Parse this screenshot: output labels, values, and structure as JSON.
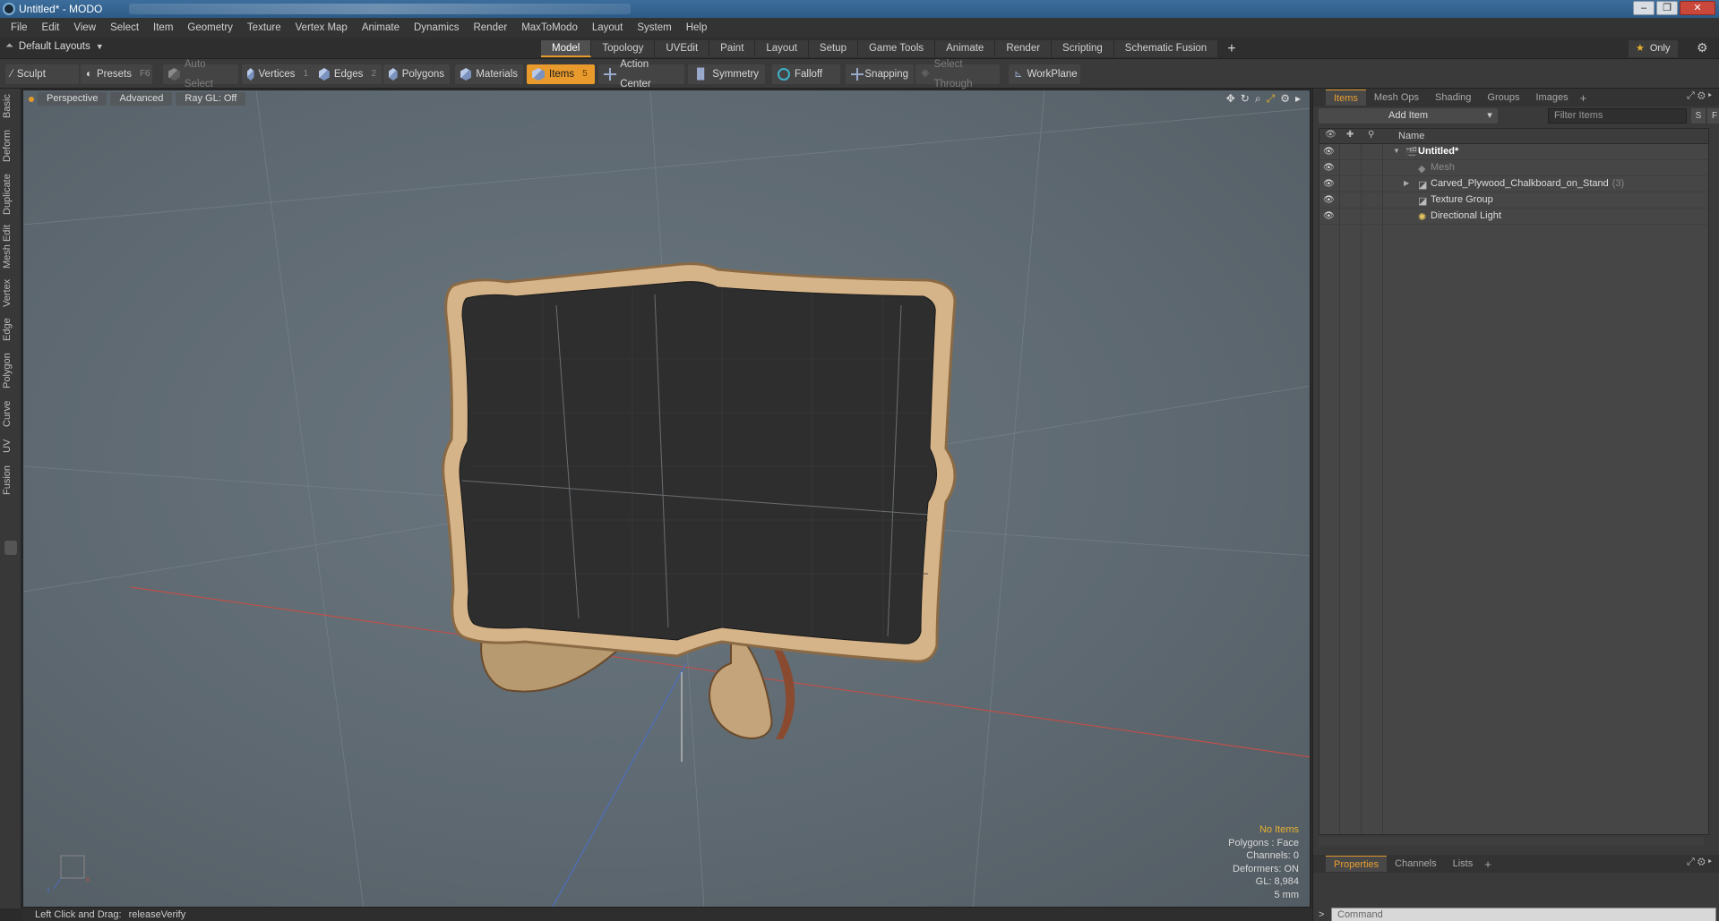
{
  "window": {
    "title": "Untitled* - MODO"
  },
  "menu": [
    "File",
    "Edit",
    "View",
    "Select",
    "Item",
    "Geometry",
    "Texture",
    "Vertex Map",
    "Animate",
    "Dynamics",
    "Render",
    "MaxToModo",
    "Layout",
    "System",
    "Help"
  ],
  "layouts": {
    "dropdown_label": "Default Layouts",
    "tabs": [
      "Model",
      "Topology",
      "UVEdit",
      "Paint",
      "Layout",
      "Setup",
      "Game Tools",
      "Animate",
      "Render",
      "Scripting",
      "Schematic Fusion"
    ],
    "active_tab": "Model",
    "only_label": "Only"
  },
  "toolbar": {
    "sculpt": "Sculpt",
    "presets": "Presets",
    "presets_key": "F6",
    "auto_select": "Auto Select",
    "vertices": "Vertices",
    "vertices_key": "1",
    "edges": "Edges",
    "edges_key": "2",
    "polygons": "Polygons",
    "materials": "Materials",
    "items": "Items",
    "items_key": "5",
    "action_center": "Action Center",
    "symmetry": "Symmetry",
    "falloff": "Falloff",
    "snapping": "Snapping",
    "select_through": "Select Through",
    "workplane": "WorkPlane"
  },
  "left_tabs": [
    "Basic",
    "Deform",
    "Duplicate",
    "Mesh Edit",
    "Vertex",
    "Edge",
    "Polygon",
    "Curve",
    "UV",
    "Fusion"
  ],
  "viewport": {
    "view_label": "Perspective",
    "shading_label": "Advanced",
    "raygl_label": "Ray GL: Off",
    "stats": {
      "no_items": "No Items",
      "polygons": "Polygons : Face",
      "channels": "Channels: 0",
      "deformers": "Deformers: ON",
      "gl": "GL: 8,984",
      "unit": "5 mm"
    }
  },
  "right_panel": {
    "tabs": [
      "Items",
      "Mesh Ops",
      "Shading",
      "Groups",
      "Images"
    ],
    "active_tab": "Items",
    "add_item": "Add Item",
    "filter_placeholder": "Filter Items",
    "s_btn": "S",
    "f_btn": "F",
    "column_name": "Name",
    "tree": [
      {
        "label": "Untitled*",
        "level": 0,
        "style": "bold"
      },
      {
        "label": "Mesh",
        "level": 1,
        "style": "dim"
      },
      {
        "label": "Carved_Plywood_Chalkboard_on_Stand",
        "level": 1,
        "style": "normal",
        "count": "(3)"
      },
      {
        "label": "Texture Group",
        "level": 1,
        "style": "normal"
      },
      {
        "label": "Directional Light",
        "level": 1,
        "style": "normal"
      }
    ],
    "bottom_tabs": [
      "Properties",
      "Channels",
      "Lists"
    ],
    "bottom_active": "Properties",
    "command_placeholder": "Command"
  },
  "status": {
    "hint": "Left Click and Drag:",
    "command": "releaseVerify"
  },
  "colors": {
    "accent": "#e39a2b",
    "chalkboard": "#2f2f2f",
    "wood": "#d9b98c"
  }
}
